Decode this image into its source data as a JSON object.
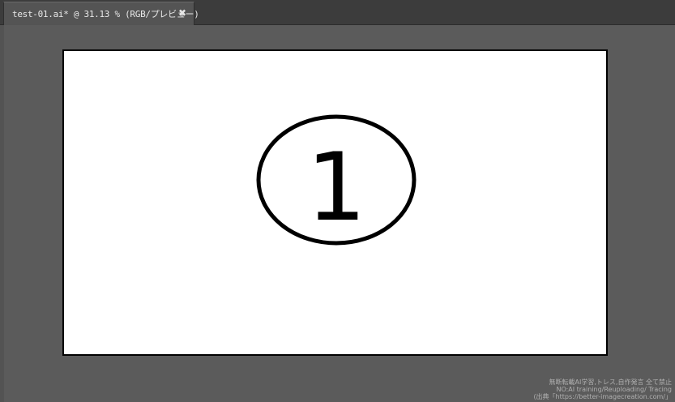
{
  "document_tab": {
    "title": "test-01.ai* @ 31.13 % (RGB/プレビュー)",
    "close_glyph": "✖"
  },
  "artboard": {
    "circled_number": "1",
    "background": "#ffffff",
    "stroke": "#000000"
  },
  "watermark": {
    "lines": [
      "無断転載AI学習,トレス,自作発言 全て禁止",
      "NO:AI training/Reuploading/ Tracing",
      "(出典「https://better-imagecreation.com/」"
    ]
  },
  "colors": {
    "workspace": "#5b5b5b",
    "tabbar": "#3c3c3c",
    "tab_active": "#545454"
  }
}
